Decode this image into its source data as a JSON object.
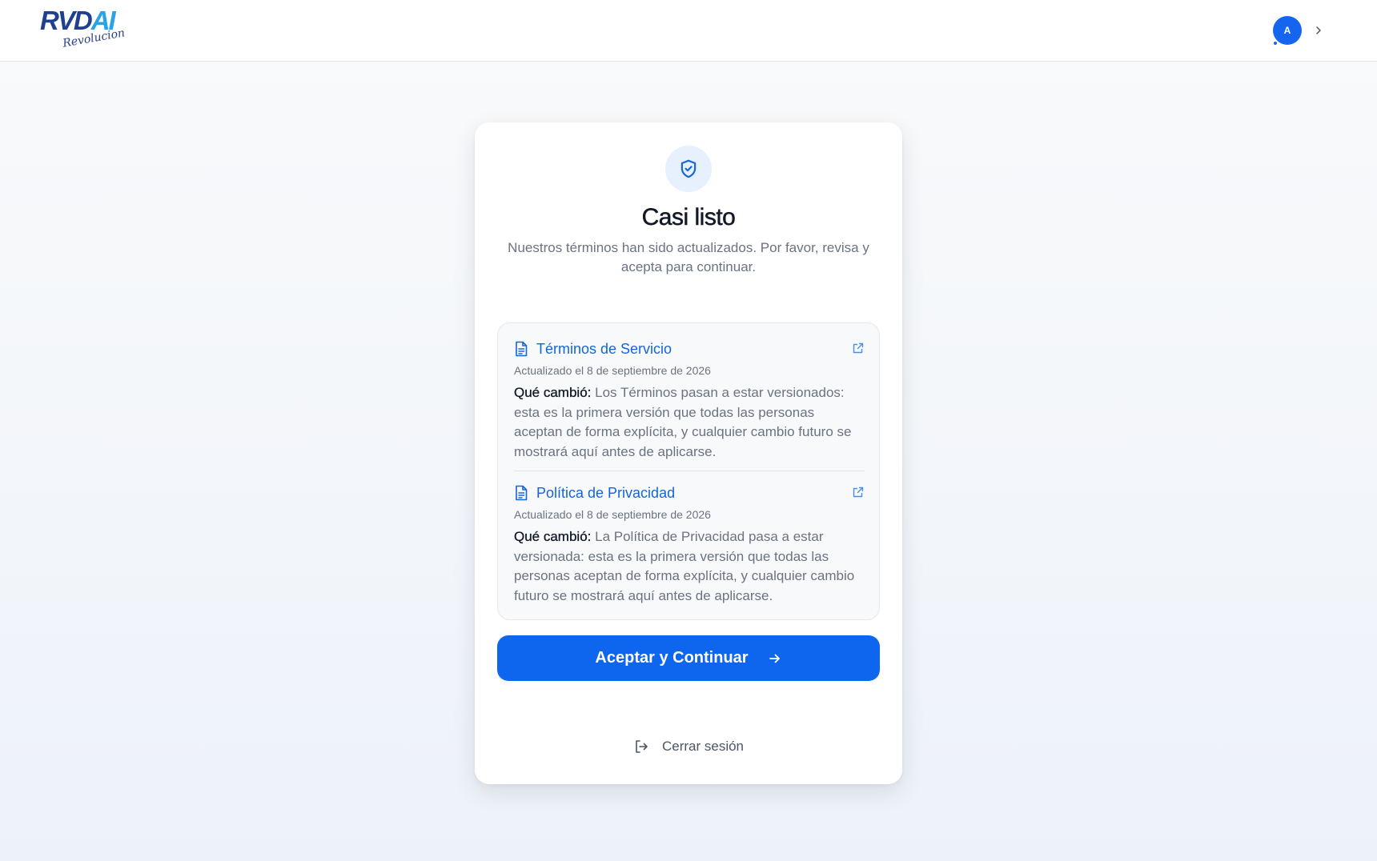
{
  "header": {
    "logo_main": "RVD",
    "logo_accent": "AI",
    "logo_script": "Revolucion",
    "avatar_initial": "A"
  },
  "card": {
    "title": "Casi listo",
    "subtitle": "Nuestros términos han sido actualizados. Por favor, revisa y acepta para continuar.",
    "documents": [
      {
        "title": "Términos de Servicio",
        "updated": "Actualizado el 8 de septiembre de 2026",
        "change_label": "Qué cambió:",
        "change_text": "Los Términos pasan a estar versionados: esta es la primera versión que todas las personas aceptan de forma explícita, y cualquier cambio futuro se mostrará aquí antes de aplicarse."
      },
      {
        "title": "Política de Privacidad",
        "updated": "Actualizado el 8 de septiembre de 2026",
        "change_label": "Qué cambió:",
        "change_text": "La Política de Privacidad pasa a estar versionada: esta es la primera versión que todas las personas aceptan de forma explícita, y cualquier cambio futuro se mostrará aquí antes de aplicarse."
      }
    ],
    "accept_button": "Aceptar y Continuar",
    "logout_label": "Cerrar sesión"
  },
  "icons": {
    "card_header": "shield-check-icon",
    "document": "document-icon",
    "external_link": "external-link-icon",
    "accept": "arrow-right-icon",
    "logout": "logout-icon",
    "avatar_menu": "chevron-right-icon"
  },
  "colors": {
    "primary": "#0f66ee",
    "link": "#1565d8",
    "brand_dark": "#1f3f8f",
    "brand_light": "#2aa2e6",
    "shield_bg": "#e7f0fd"
  }
}
